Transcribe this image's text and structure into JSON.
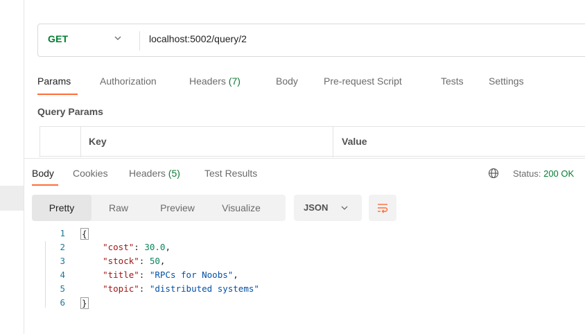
{
  "request": {
    "method": "GET",
    "url": "localhost:5002/query/2",
    "tabs": [
      {
        "label": "Params"
      },
      {
        "label": "Authorization"
      },
      {
        "label": "Headers",
        "count": "(7)"
      },
      {
        "label": "Body"
      },
      {
        "label": "Pre-request Script"
      },
      {
        "label": "Tests"
      },
      {
        "label": "Settings"
      }
    ],
    "query_params_label": "Query Params",
    "table": {
      "key_header": "Key",
      "value_header": "Value"
    }
  },
  "response": {
    "tabs": [
      {
        "label": "Body"
      },
      {
        "label": "Cookies"
      },
      {
        "label": "Headers",
        "count": "(5)"
      },
      {
        "label": "Test Results"
      }
    ],
    "status_label": "Status:",
    "status_value": "200 OK",
    "view_modes": [
      "Pretty",
      "Raw",
      "Preview",
      "Visualize"
    ],
    "format": "JSON",
    "code_lines": [
      {
        "n": "1",
        "text": "{"
      },
      {
        "n": "2",
        "key": "\"cost\"",
        "value": "30.0",
        "type": "num"
      },
      {
        "n": "3",
        "key": "\"stock\"",
        "value": "50",
        "type": "num"
      },
      {
        "n": "4",
        "key": "\"title\"",
        "value": "\"RPCs for Noobs\"",
        "type": "str"
      },
      {
        "n": "5",
        "key": "\"topic\"",
        "value": "\"distributed systems\"",
        "type": "str",
        "last": true
      },
      {
        "n": "6",
        "text": "}"
      }
    ]
  },
  "colors": {
    "method": "#007f31",
    "accent": "#ff6c37",
    "status_ok": "#007f31",
    "json_key": "#a31515",
    "json_string": "#0451a5",
    "json_number": "#098658"
  },
  "icons": [
    "chevron-down-icon",
    "globe-icon",
    "word-wrap-icon"
  ]
}
